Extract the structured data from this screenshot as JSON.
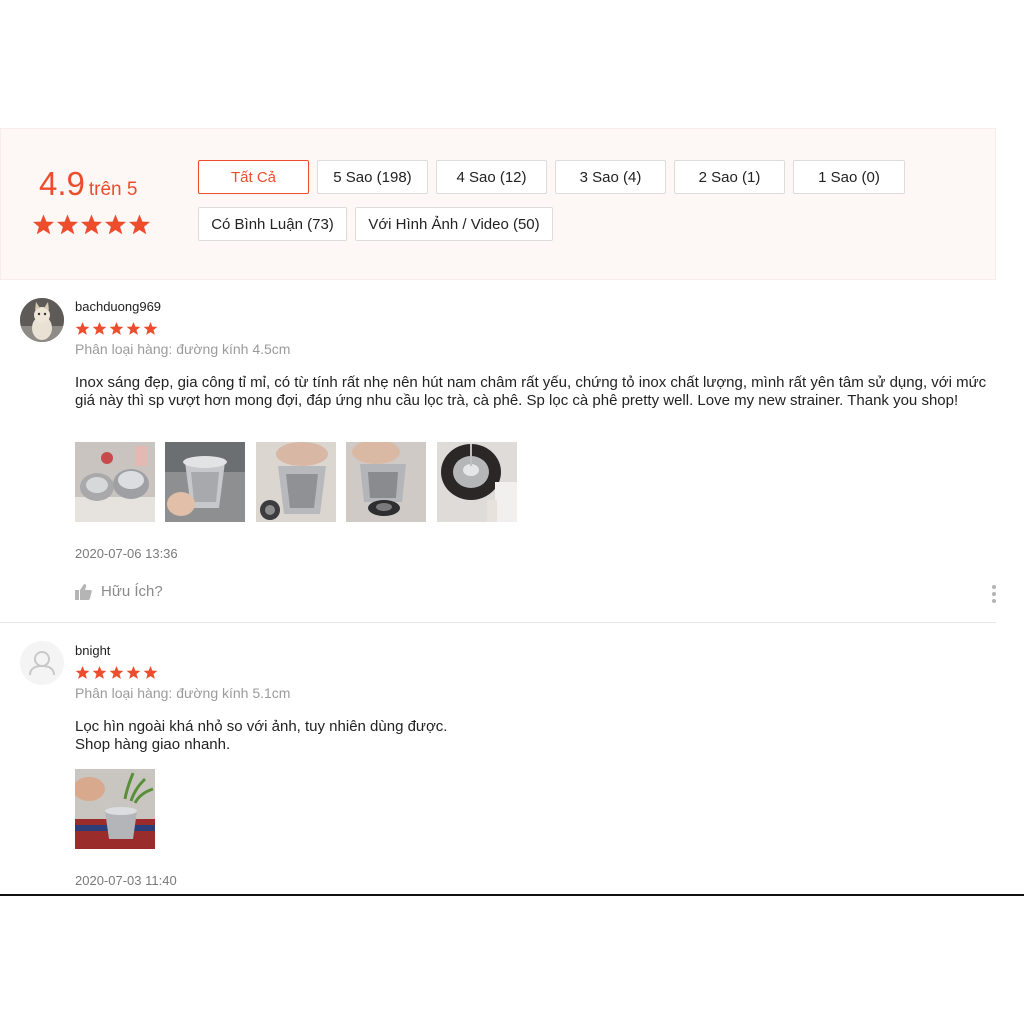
{
  "summary": {
    "rating": "4.9",
    "rating_suffix": "trên 5",
    "stars": 5,
    "filters": [
      {
        "label": "Tất Cả",
        "active": true
      },
      {
        "label": "5 Sao (198)"
      },
      {
        "label": "4 Sao (12)"
      },
      {
        "label": "3 Sao (4)"
      },
      {
        "label": "2 Sao (1)"
      },
      {
        "label": "1 Sao (0)"
      },
      {
        "label": "Có Bình Luận (73)"
      },
      {
        "label": "Với Hình Ảnh / Video (50)"
      }
    ]
  },
  "reviews": [
    {
      "username": "bachduong969",
      "stars": 5,
      "variant": "Phân loại hàng: đường kính 4.5cm",
      "content": [
        "Inox sáng đẹp, gia công tỉ mỉ, có từ tính rất nhẹ nên hút nam châm rất yếu, chứng tỏ inox chất lượng, mình rất yên tâm sử dụng, với mức giá này thì sp vượt hơn mong đợi, đáp ứng nhu cầu lọc trà, cà phê. Sp lọc cà phê pretty well. Love my new strainer. Thank you shop!"
      ],
      "timestamp": "2020-07-06 13:36",
      "helpful_label": "Hữu Ích?",
      "photo_count": 5
    },
    {
      "username": "bnight",
      "stars": 5,
      "variant": "Phân loại hàng: đường kính 5.1cm",
      "content": [
        "Lọc hìn ngoài khá nhỏ so với ảnh, tuy nhiên dùng được.",
        "Shop hàng giao nhanh."
      ],
      "timestamp": "2020-07-03 11:40",
      "photo_count": 1
    }
  ],
  "colors": {
    "accent": "#ee4d2d",
    "summary_bg": "#fdf7f5",
    "muted_text": "#9b9b9b"
  },
  "icons": [
    "star-icon",
    "thumbs-up-icon",
    "more-options-icon",
    "default-user-avatar-icon"
  ]
}
